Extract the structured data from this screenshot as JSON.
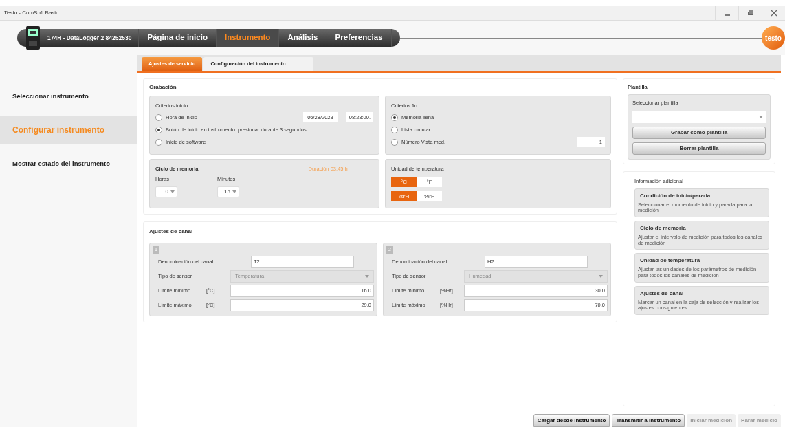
{
  "window": {
    "title": "Testo - ComSoft Basic",
    "controls": [
      {
        "kind": "minimize"
      },
      {
        "kind": "restore"
      },
      {
        "kind": "close"
      }
    ]
  },
  "nav": {
    "device": "174H - DataLogger 2 84252530",
    "tabs": [
      {
        "label": "Página de inicio",
        "selected": false
      },
      {
        "label": "Instrumento",
        "selected": true
      },
      {
        "label": "Análisis",
        "selected": false
      },
      {
        "label": "Preferencias",
        "selected": false
      }
    ],
    "logo": "testo"
  },
  "sidebar": {
    "items": [
      {
        "label": "Seleccionar instrumento",
        "selected": false
      },
      {
        "label": "Configurar instrumento",
        "selected": true
      },
      {
        "label": "Mostrar estado del instrumento",
        "selected": false
      }
    ]
  },
  "subtabs": [
    {
      "label": "Ajustes de servicio",
      "selected": true
    },
    {
      "label": "Configuración del instrumento",
      "selected": false
    }
  ],
  "recording": {
    "title": "Grabación",
    "start": {
      "title": "Criterios inicio",
      "options": [
        {
          "label": "Hora de inicio",
          "selected": false
        },
        {
          "label": "Botón de inicio en instrumento: presionar durante 3 segundos",
          "selected": true
        },
        {
          "label": "Inicio de software",
          "selected": false
        }
      ],
      "date": "06/28/2023",
      "time": "08:23:00."
    },
    "end": {
      "title": "Criterios fin",
      "options": [
        {
          "label": "Memoria llena",
          "selected": true
        },
        {
          "label": "Lista circular",
          "selected": false
        },
        {
          "label": "Número Vista med.",
          "selected": false
        }
      ],
      "count": "1"
    },
    "cycle": {
      "title": "Ciclo de memoria",
      "duration": "Duración 03:45 h",
      "hours_label": "Horas",
      "hours": "0",
      "minutes_label": "Minutos",
      "minutes": "15"
    },
    "units": {
      "title": "Unidad de temperatura",
      "rows": [
        [
          {
            "label": "°C",
            "selected": true
          },
          {
            "label": "°F",
            "selected": false
          }
        ],
        [
          {
            "label": "%rH",
            "selected": true
          },
          {
            "label": "%rF",
            "selected": false
          }
        ]
      ]
    }
  },
  "channels": {
    "title": "Ajustes de canal",
    "items": [
      {
        "number": "1",
        "name_label": "Denominación del canal",
        "name": "T2",
        "sensor_label": "Tipo de sensor",
        "sensor": "Temperatura",
        "min_label": "Límite mínimo",
        "min_unit": "[°C]",
        "min": "16.0",
        "max_label": "Límite máximo",
        "max_unit": "[°C]",
        "max": "29.0"
      },
      {
        "number": "2",
        "name_label": "Denominación del canal",
        "name": "H2",
        "sensor_label": "Tipo de sensor",
        "sensor": "Humedad",
        "min_label": "Límite mínimo",
        "min_unit": "[%Hr]",
        "min": "30.0",
        "max_label": "Límite máximo",
        "max_unit": "[%Hr]",
        "max": "70.0"
      }
    ]
  },
  "template": {
    "title": "Plantilla",
    "select_label": "Seleccionar plantilla",
    "buttons": [
      "Grabar como plantilla",
      "Borrar plantilla"
    ]
  },
  "info": {
    "title": "Información adicional",
    "cards": [
      {
        "title": "Condición de inicio/parada",
        "text": "Seleccionar el momento de inicio y parada para la medición"
      },
      {
        "title": "Ciclo de memoria",
        "text": "Ajustar el intervalo de medición para todos los canales de medición"
      },
      {
        "title": "Unidad de temperatura",
        "text": "Ajustar las unidades de los parámetros de medición para todos los canales de medición"
      },
      {
        "title": "Ajustes de canal",
        "text": "Marcar un canal en la caja de selección y realizar los ajustes consiguientes"
      }
    ]
  },
  "actions": [
    {
      "label": "Cargar desde instrumento",
      "disabled": false
    },
    {
      "label": "Transmitir a instrumento",
      "disabled": false
    },
    {
      "label": "Iniciar medición",
      "disabled": true
    },
    {
      "label": "Parar medició",
      "disabled": true
    }
  ]
}
